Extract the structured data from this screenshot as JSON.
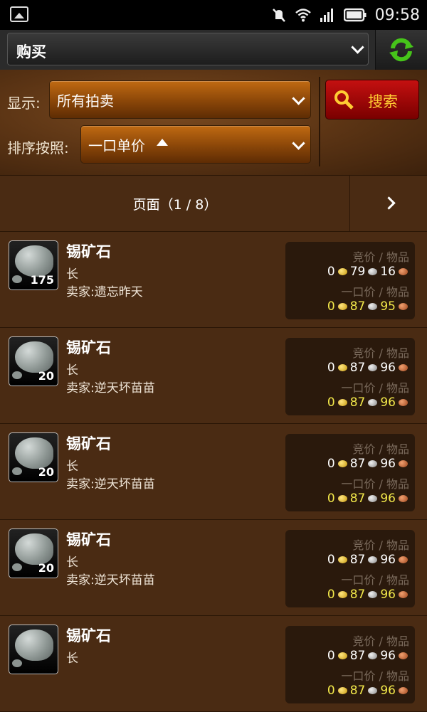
{
  "status_bar": {
    "time": "09:58"
  },
  "top_bar": {
    "category": "购买"
  },
  "filters": {
    "display_label": "显示:",
    "display_value": "所有拍卖",
    "sort_label": "排序按照:",
    "sort_value": "一口单价",
    "search_label": "搜索"
  },
  "pager": {
    "text": "页面（1 / 8）"
  },
  "colors": {
    "accent_orange": "#a0520a",
    "search_red": "#b00a0a",
    "buyout_yellow": "#f2e84a"
  },
  "labels": {
    "bid_per_item": "竞价 / 物品",
    "buyout_per_item": "一口价 / 物品"
  },
  "items": [
    {
      "name": "锡矿石",
      "qty": "175",
      "duration": "长",
      "seller": "卖家:遗忘昨天",
      "bid": {
        "g": "0",
        "s": "79",
        "c": "16"
      },
      "buyout": {
        "g": "0",
        "s": "87",
        "c": "95"
      }
    },
    {
      "name": "锡矿石",
      "qty": "20",
      "duration": "长",
      "seller": "卖家:逆天坏苗苗",
      "bid": {
        "g": "0",
        "s": "87",
        "c": "96"
      },
      "buyout": {
        "g": "0",
        "s": "87",
        "c": "96"
      }
    },
    {
      "name": "锡矿石",
      "qty": "20",
      "duration": "长",
      "seller": "卖家:逆天坏苗苗",
      "bid": {
        "g": "0",
        "s": "87",
        "c": "96"
      },
      "buyout": {
        "g": "0",
        "s": "87",
        "c": "96"
      }
    },
    {
      "name": "锡矿石",
      "qty": "20",
      "duration": "长",
      "seller": "卖家:逆天坏苗苗",
      "bid": {
        "g": "0",
        "s": "87",
        "c": "96"
      },
      "buyout": {
        "g": "0",
        "s": "87",
        "c": "96"
      }
    },
    {
      "name": "锡矿石",
      "qty": "",
      "duration": "长",
      "seller": "",
      "bid": {
        "g": "0",
        "s": "87",
        "c": "96"
      },
      "buyout": {
        "g": "0",
        "s": "87",
        "c": "96"
      }
    }
  ]
}
